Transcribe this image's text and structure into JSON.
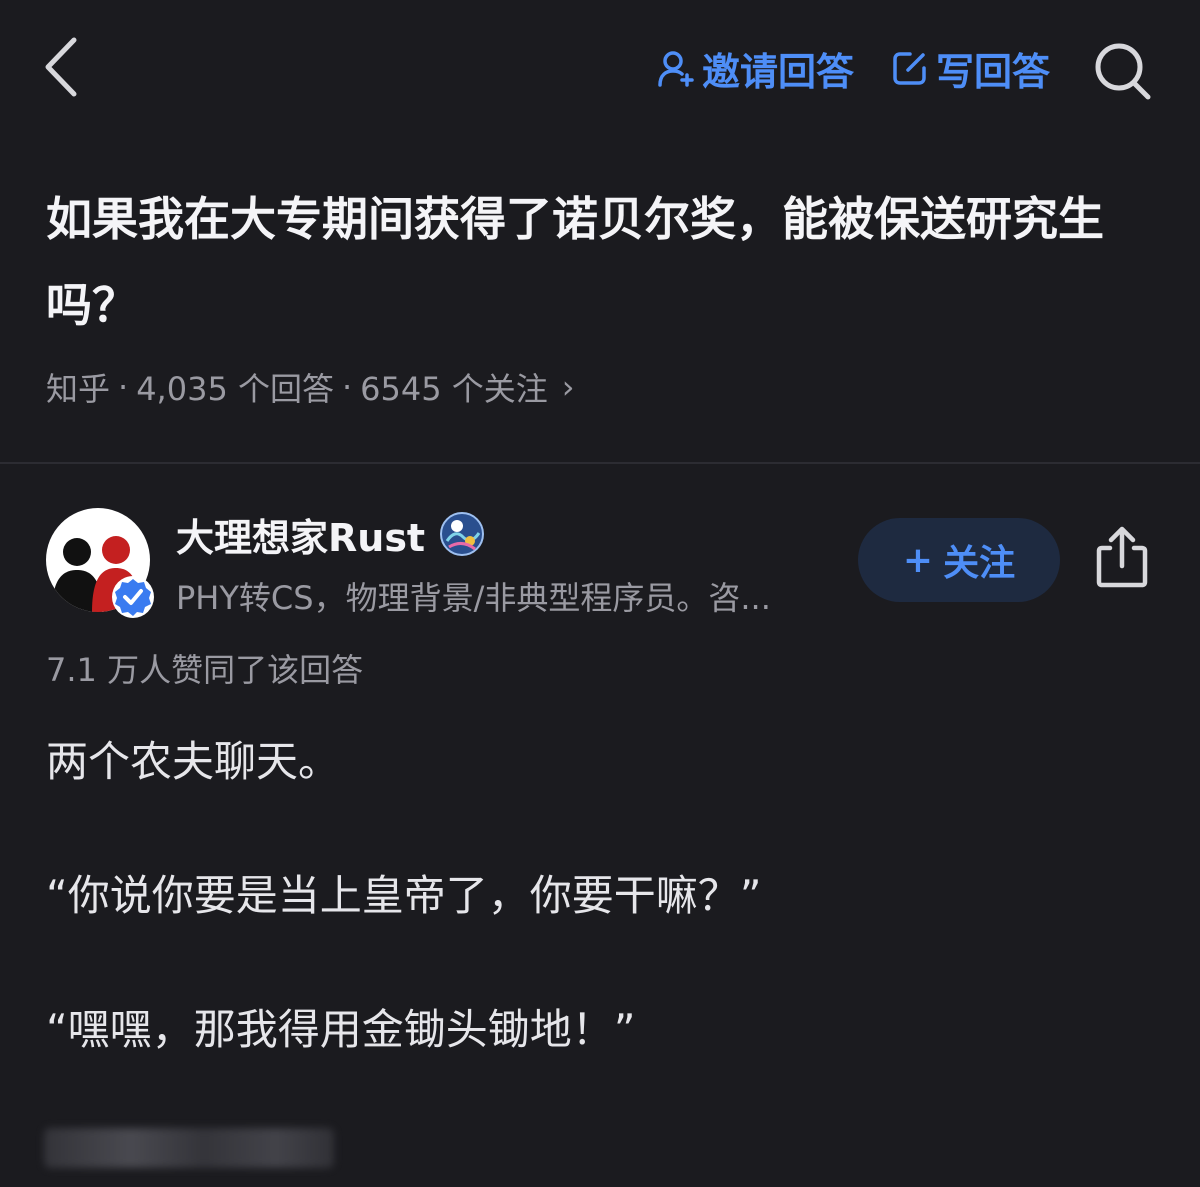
{
  "header": {
    "invite_label": "邀请回答",
    "write_label": "写回答",
    "accent_color": "#4e8ef7",
    "icons": [
      "chevron-left-icon",
      "person-add-icon",
      "edit-icon",
      "search-icon"
    ]
  },
  "question": {
    "title": "如果我在大专期间获得了诺贝尔奖，能被保送研究生吗？",
    "source": "知乎",
    "sep": "·",
    "answers": "4,035 个回答",
    "followers": "6545 个关注",
    "chevron": "›"
  },
  "author": {
    "name": "大理想家Rust",
    "bio": "PHY转CS，物理背景/非典型程序员。咨...",
    "follow_plus": "+",
    "follow_label": "关注",
    "icons": [
      "avatar",
      "verified-check-icon",
      "creator-badge-icon",
      "share-icon"
    ]
  },
  "answer": {
    "upvotes": "7.1 万人赞同了该回答",
    "lines": [
      "两个农夫聊天。",
      "“你说你要是当上皇帝了，你要干嘛？”",
      "“嘿嘿，那我得用金锄头锄地！”"
    ]
  }
}
